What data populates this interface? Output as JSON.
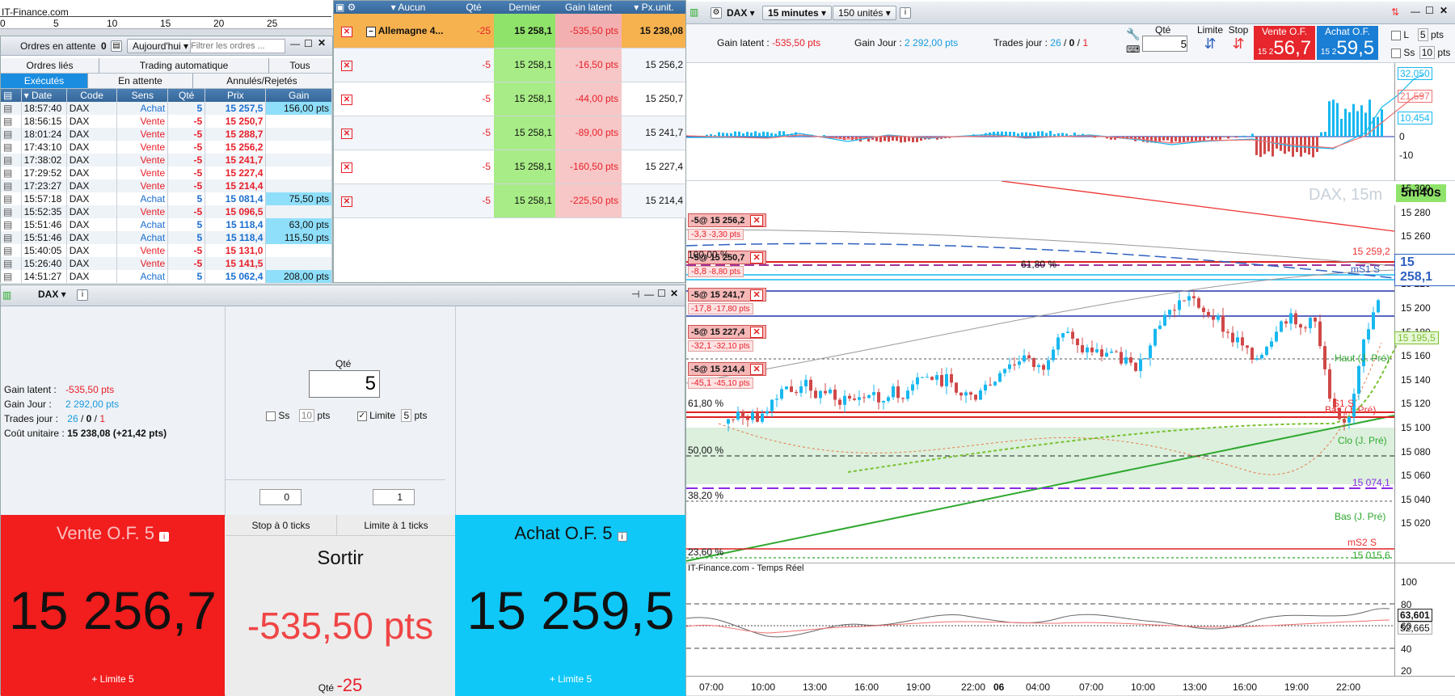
{
  "top_axis": {
    "site": "IT-Finance.com",
    "ticks": [
      "0",
      "5",
      "10",
      "15",
      "20",
      "25"
    ]
  },
  "orders": {
    "title": "Ordres en attente",
    "count": "0",
    "period": "Aujourd'hui",
    "filter_placeholder": "Filtrer les ordres ...",
    "tabs_row1": [
      "Ordres liés",
      "Trading automatique",
      "Tous"
    ],
    "tabs_row2": [
      "Exécutés",
      "En attente",
      "Annulés/Rejetés"
    ],
    "columns": [
      "Date",
      "Code",
      "Sens",
      "Qté",
      "Prix",
      "Gain"
    ],
    "rows": [
      {
        "date": "18:57:40",
        "code": "DAX",
        "sens": "Achat",
        "qte": "5",
        "prix": "15 257,5",
        "gain": "156,00 pts"
      },
      {
        "date": "18:56:15",
        "code": "DAX",
        "sens": "Vente",
        "qte": "-5",
        "prix": "15 250,7",
        "gain": ""
      },
      {
        "date": "18:01:24",
        "code": "DAX",
        "sens": "Vente",
        "qte": "-5",
        "prix": "15 288,7",
        "gain": ""
      },
      {
        "date": "17:43:10",
        "code": "DAX",
        "sens": "Vente",
        "qte": "-5",
        "prix": "15 256,2",
        "gain": ""
      },
      {
        "date": "17:38:02",
        "code": "DAX",
        "sens": "Vente",
        "qte": "-5",
        "prix": "15 241,7",
        "gain": ""
      },
      {
        "date": "17:29:52",
        "code": "DAX",
        "sens": "Vente",
        "qte": "-5",
        "prix": "15 227,4",
        "gain": ""
      },
      {
        "date": "17:23:27",
        "code": "DAX",
        "sens": "Vente",
        "qte": "-5",
        "prix": "15 214,4",
        "gain": ""
      },
      {
        "date": "15:57:18",
        "code": "DAX",
        "sens": "Achat",
        "qte": "5",
        "prix": "15 081,4",
        "gain": "75,50 pts"
      },
      {
        "date": "15:52:35",
        "code": "DAX",
        "sens": "Vente",
        "qte": "-5",
        "prix": "15 096,5",
        "gain": ""
      },
      {
        "date": "15:51:46",
        "code": "DAX",
        "sens": "Achat",
        "qte": "5",
        "prix": "15 118,4",
        "gain": "63,00 pts"
      },
      {
        "date": "15:51:46",
        "code": "DAX",
        "sens": "Achat",
        "qte": "5",
        "prix": "15 118,4",
        "gain": "115,50 pts"
      },
      {
        "date": "15:40:05",
        "code": "DAX",
        "sens": "Vente",
        "qte": "-5",
        "prix": "15 131,0",
        "gain": ""
      },
      {
        "date": "15:26:40",
        "code": "DAX",
        "sens": "Vente",
        "qte": "-5",
        "prix": "15 141,5",
        "gain": ""
      },
      {
        "date": "14:51:27",
        "code": "DAX",
        "sens": "Achat",
        "qte": "5",
        "prix": "15 062,4",
        "gain": "208,00 pts"
      }
    ]
  },
  "positions": {
    "columns": [
      "Aucun",
      "Qté",
      "Dernier",
      "Gain latent",
      "Px.unit."
    ],
    "summary": {
      "name": "Allemagne 4...",
      "qte": "-25",
      "dernier": "15 258,1",
      "gain": "-535,50 pts",
      "px": "15 238,08"
    },
    "rows": [
      {
        "qte": "-5",
        "dernier": "15 258,1",
        "gain": "-16,50 pts",
        "px": "15 256,2"
      },
      {
        "qte": "-5",
        "dernier": "15 258,1",
        "gain": "-44,00 pts",
        "px": "15 250,7"
      },
      {
        "qte": "-5",
        "dernier": "15 258,1",
        "gain": "-89,00 pts",
        "px": "15 241,7"
      },
      {
        "qte": "-5",
        "dernier": "15 258,1",
        "gain": "-160,50 pts",
        "px": "15 227,4"
      },
      {
        "qte": "-5",
        "dernier": "15 258,1",
        "gain": "-225,50 pts",
        "px": "15 214,4"
      }
    ]
  },
  "ticket": {
    "symbol": "DAX",
    "gain_latent_label": "Gain latent :",
    "gain_latent": "-535,50 pts",
    "gain_jour_label": "Gain Jour :",
    "gain_jour": "2 292,00 pts",
    "trades_label": "Trades jour :",
    "trades_a": "26",
    "trades_b": "0",
    "trades_c": "1",
    "cout_label": "Coût unitaire :",
    "cout": "15 238,08 (+21,42 pts)",
    "qty_label": "Qté",
    "qty": "5",
    "ss_label": "Ss",
    "ss_val": "10",
    "pts": "pts",
    "limite_label": "Limite",
    "limite_val": "5",
    "spin_left": "0",
    "spin_right": "1",
    "sell_title": "Vente O.F. 5",
    "sell_price": "15 256,7",
    "sell_sub": "+ Limite 5",
    "buy_title": "Achat O.F. 5",
    "buy_price": "15 259,5",
    "buy_sub": "+ Limite 5",
    "stop_label": "Stop à 0 ticks",
    "limit_label": "Limite à 1 ticks",
    "exit_label": "Sortir",
    "exit_gain": "-535,50 pts",
    "exit_qty_label": "Qté",
    "exit_qty": "-25"
  },
  "chart": {
    "symbol": "DAX",
    "interval": "15 minutes",
    "units": "150 unités",
    "gain_latent_label": "Gain latent :",
    "gain_latent": "-535,50 pts",
    "gain_jour_label": "Gain Jour :",
    "gain_jour": "2 292,00 pts",
    "trades_label": "Trades jour :",
    "trades_a": "26",
    "trades_b": "0",
    "trades_c": "1",
    "qty_label": "Qté",
    "qty": "5",
    "limite": "Limite",
    "stop": "Stop",
    "sell_label": "Vente O.F.",
    "sell_small": "15 2",
    "sell_big": "56,7",
    "buy_label": "Achat O.F.",
    "buy_small": "15 2",
    "buy_big": "59,5",
    "l_label": "L",
    "l_val": "5",
    "ss_label": "Ss",
    "ss_val": "10",
    "pts": "pts",
    "watermark": "DAX, 15m",
    "countdown": "5m40s",
    "source": "IT-Finance.com - Temps Réel",
    "macd_levels": [
      "32,050",
      "21,597",
      "10,454",
      "0",
      "-10"
    ],
    "price_ticks": [
      "15 300",
      "15 280",
      "15 260",
      "15 240",
      "15 220",
      "15 200",
      "15 180",
      "15 160",
      "15 140",
      "15 120",
      "15 100",
      "15 080",
      "15 060",
      "15 040",
      "15 020"
    ],
    "last_price": "15 258,1",
    "price_tag_2": "15 195,5",
    "osc_ticks": [
      "100",
      "80",
      "60",
      "40",
      "20"
    ],
    "osc_val1": "63,601",
    "osc_val2": "52,665",
    "time_ticks": [
      "07:00",
      "10:00",
      "13:00",
      "16:00",
      "19:00",
      "22:00",
      "06",
      "04:00",
      "07:00",
      "10:00",
      "13:00",
      "16:00",
      "19:00",
      "22:00"
    ],
    "order_tags": [
      {
        "label": "-5@ 15 256,2",
        "d1": "-3,3",
        "d2": "-3,30 pts"
      },
      {
        "label": "-5@ 15 250,7",
        "d1": "-8,8",
        "d2": "-8,80 pts"
      },
      {
        "label": "-5@ 15 241,7",
        "d1": "-17,8",
        "d2": "-17,80 pts"
      },
      {
        "label": "-5@ 15 227,4",
        "d1": "-32,1",
        "d2": "-32,10 pts"
      },
      {
        "label": "-5@ 15 214,4",
        "d1": "-45,1",
        "d2": "-45,10 pts"
      }
    ],
    "fibs": [
      "61,80 %",
      "50,00 %",
      "38,20 %",
      "23,60 %"
    ],
    "fib_top": "100,00 %",
    "fib_6180_mid": "61,80 %",
    "levels": [
      "15 259,2",
      "mS1 S",
      "Haut (J. Pré)",
      "S1 S",
      "Bas (J. Pré)",
      "Clo (J. Pré)",
      "15 074,1",
      "Bas (J. Pré)",
      "mS2 S",
      "15 015,6"
    ]
  }
}
